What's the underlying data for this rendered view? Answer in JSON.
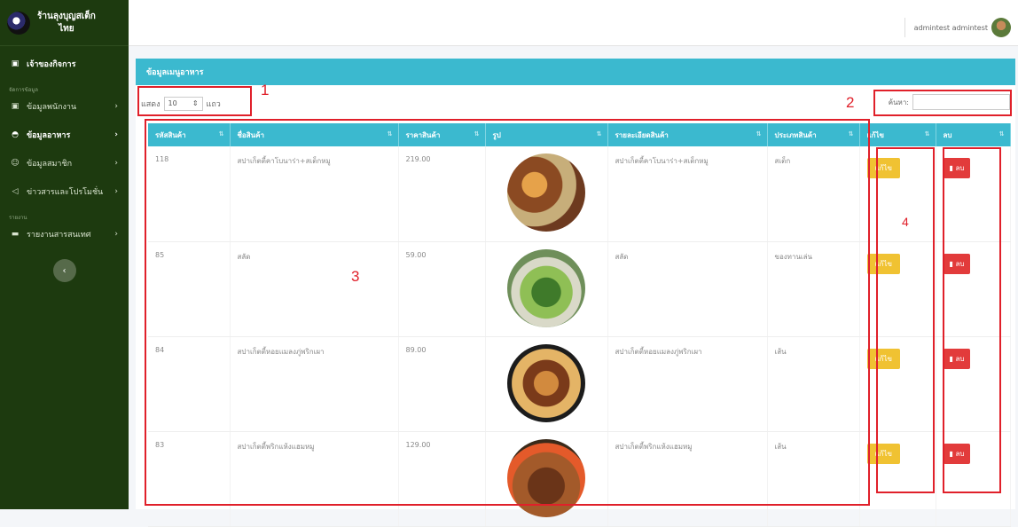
{
  "sidebar": {
    "brand_line1": "ร้านลุงบุญสเต็ก",
    "brand_line2": "ไทย",
    "items": [
      {
        "label": "เจ้าของกิจการ",
        "icon": "id-card-icon",
        "glyph": "▣"
      },
      {
        "label": "ข้อมูลพนักงาน",
        "icon": "id-card-icon",
        "glyph": "▣"
      },
      {
        "label": "ข้อมูลอาหาร",
        "icon": "food-icon",
        "glyph": "◓"
      },
      {
        "label": "ข้อมูลสมาชิก",
        "icon": "users-icon",
        "glyph": "☺"
      },
      {
        "label": "ข่าวสารและโปรโมชั่น",
        "icon": "megaphone-icon",
        "glyph": "◁"
      },
      {
        "label": "รายงานสารสนเทศ",
        "icon": "folder-icon",
        "glyph": "▬"
      }
    ],
    "section1": "จัดการข้อมูล",
    "section2": "รายงาน",
    "collapse": "‹"
  },
  "topbar": {
    "user": "admintest admintest"
  },
  "card": {
    "title": "ข้อมูลเมนูอาหาร",
    "show_label": "แสดง",
    "show_value": "10",
    "rows_label": "แถว",
    "search_label": "ค้นหา:"
  },
  "table": {
    "headers": [
      "รหัสสินค้า",
      "ชื่อสินค้า",
      "ราคาสินค้า",
      "รูป",
      "รายละเอียดสินค้า",
      "ประเภทสินค้า",
      "แก้ไข",
      "ลบ"
    ],
    "rows": [
      {
        "id": "118",
        "name": "สปาเก็ตตี้คาโบนาร่า+สเต็กหมู",
        "price": "219.00",
        "detail": "สปาเก็ตตี้คาโบนาร่า+สเต็กหมู",
        "type": "สเต็ก"
      },
      {
        "id": "85",
        "name": "สลัด",
        "price": "59.00",
        "detail": "สลัด",
        "type": "ของทานเล่น"
      },
      {
        "id": "84",
        "name": "สปาเก็ตตี้หอยแมลงภู่พริกเผา",
        "price": "89.00",
        "detail": "สปาเก็ตตี้หอยแมลงภู่พริกเผา",
        "type": "เส้น"
      },
      {
        "id": "83",
        "name": "สปาเก็ตตี้พริกแห้งแฮมหมู",
        "price": "129.00",
        "detail": "สปาเก็ตตี้พริกแห้งแฮมหมู",
        "type": "เส้น"
      }
    ],
    "edit_label": "แก้ไข",
    "delete_label": "ลบ"
  },
  "annotations": {
    "n1": "1",
    "n2": "2",
    "n3": "3",
    "n4": "4"
  },
  "colors": {
    "sidebar": "#1d3a0f",
    "header": "#3bb9cf",
    "edit": "#f0c232",
    "delete": "#e23b3b",
    "annotation": "#e0202a"
  }
}
